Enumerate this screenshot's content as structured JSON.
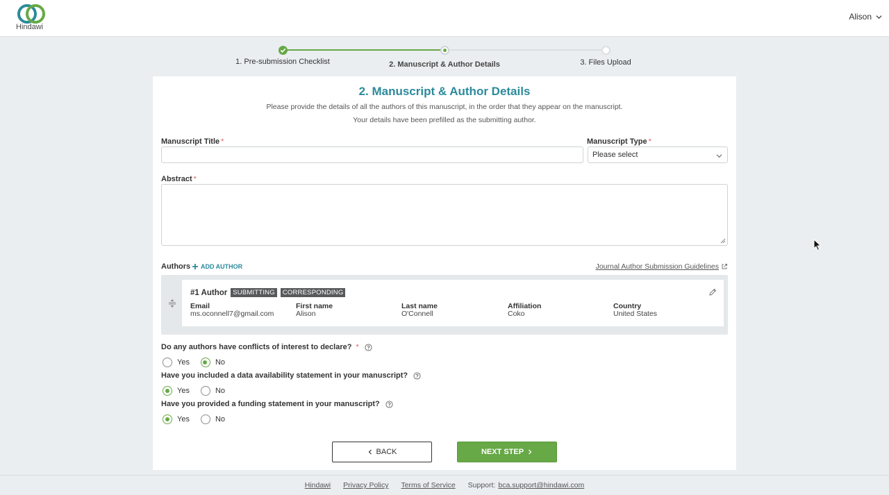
{
  "header": {
    "logo_text": "Hindawi",
    "user_name": "Alison"
  },
  "stepper": {
    "steps": [
      {
        "label": "1. Pre-submission Checklist",
        "state": "done"
      },
      {
        "label": "2. Manuscript & Author Details",
        "state": "current"
      },
      {
        "label": "3. Files Upload",
        "state": "todo"
      }
    ]
  },
  "form": {
    "title": "2. Manuscript & Author Details",
    "subtitle_1": "Please provide the details of all the authors of this manuscript, in the order that they appear on the manuscript.",
    "subtitle_2": "Your details have been prefilled as the submitting author.",
    "manuscript_title_label": "Manuscript Title",
    "manuscript_title_value": "",
    "manuscript_type_label": "Manuscript Type",
    "manuscript_type_value": "Please select",
    "abstract_label": "Abstract",
    "abstract_value": "",
    "required_mark": "*"
  },
  "authors": {
    "section_label": "Authors",
    "add_label": "ADD AUTHOR",
    "guidelines_link": "Journal Author Submission Guidelines",
    "list": [
      {
        "heading": "#1 Author",
        "tags": [
          "SUBMITTING",
          "CORRESPONDING"
        ],
        "fields": {
          "email_label": "Email",
          "email": "ms.oconnell7@gmail.com",
          "first_label": "First name",
          "first": "Alison",
          "last_label": "Last name",
          "last": "O'Connell",
          "aff_label": "Affiliation",
          "aff": "Coko",
          "country_label": "Country",
          "country": "United States"
        }
      }
    ]
  },
  "questions": [
    {
      "text": "Do any authors have conflicts of interest to declare?",
      "required": true,
      "yes": "Yes",
      "no": "No",
      "selected": "No"
    },
    {
      "text": "Have you included a data availability statement in your manuscript?",
      "required": false,
      "yes": "Yes",
      "no": "No",
      "selected": "Yes"
    },
    {
      "text": "Have you provided a funding statement in your manuscript?",
      "required": false,
      "yes": "Yes",
      "no": "No",
      "selected": "Yes"
    }
  ],
  "buttons": {
    "back": "BACK",
    "next": "NEXT STEP"
  },
  "footer": {
    "links": [
      "Hindawi",
      "Privacy Policy",
      "Terms of Service"
    ],
    "support_label": "Support:",
    "support_email": "bca.support@hindawi.com"
  },
  "colors": {
    "accent": "#2b8a9b",
    "success": "#67a847",
    "required": "#e25d5d",
    "tag_bg": "#58595b"
  },
  "icons": [
    "hindawi-logo-icon",
    "chevron-down-icon",
    "check-icon",
    "plus-icon",
    "external-link-icon",
    "drag-handle-icon",
    "pencil-icon",
    "help-circle-icon",
    "chevron-left-icon",
    "chevron-right-icon"
  ]
}
